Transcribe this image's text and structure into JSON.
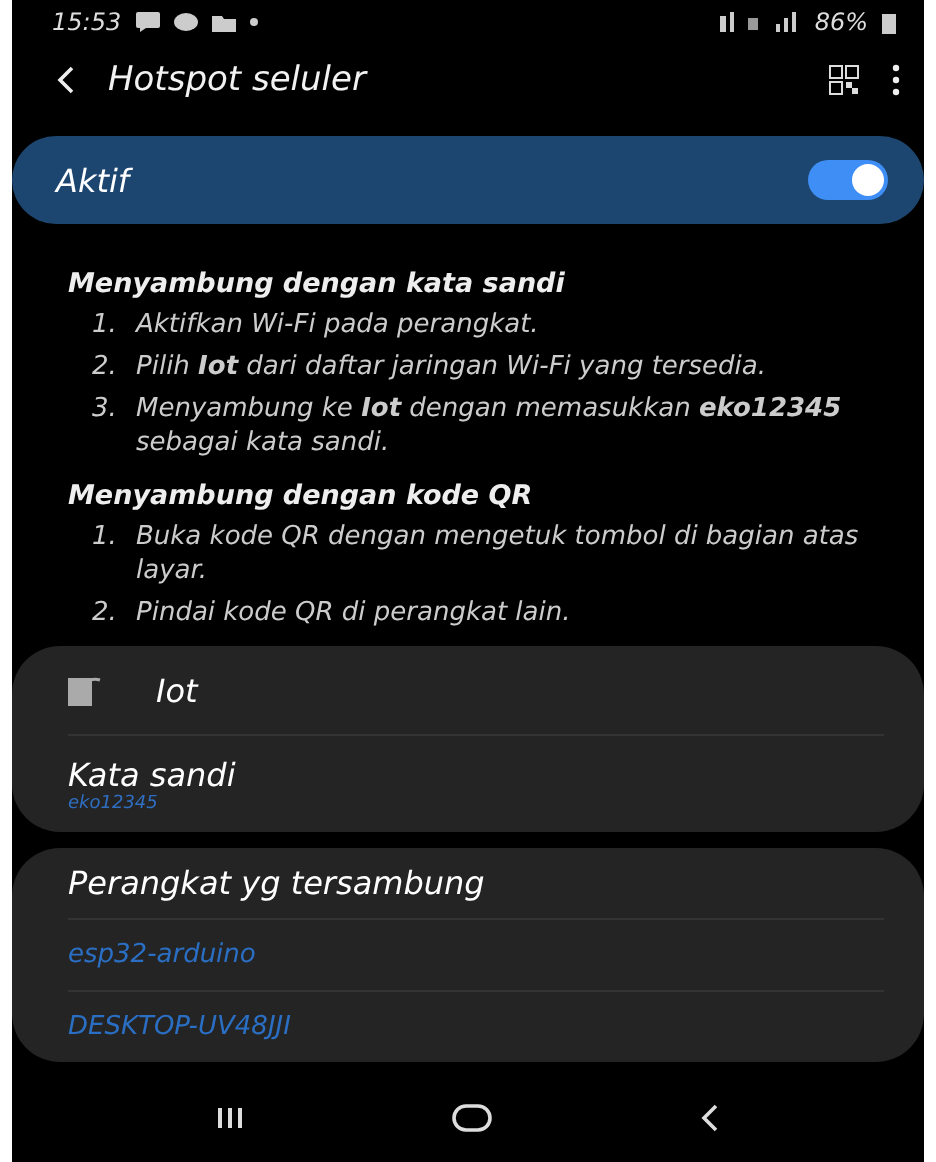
{
  "status_bar": {
    "time": "15:53",
    "battery": "86%"
  },
  "app_bar": {
    "title": "Hotspot seluler"
  },
  "master_switch": {
    "label": "Aktif",
    "on": true
  },
  "sections": [
    {
      "heading": "Menyambung dengan kata sandi",
      "steps": [
        {
          "number": "1.",
          "text": "Aktifkan Wi-Fi pada perangkat."
        },
        {
          "number": "2.",
          "text": "Pilih **Iot** dari daftar jaringan Wi-Fi yang tersedia."
        },
        {
          "number": "3.",
          "text": "Menyambung ke **Iot** dengan memasukkan **eko12345** sebagai kata sandi."
        }
      ]
    },
    {
      "heading": "Menyambung dengan kode QR",
      "steps": [
        {
          "number": "1.",
          "text": "Buka kode QR dengan mengetuk tombol di bagian atas layar."
        },
        {
          "number": "2.",
          "text": "Pindai kode QR di perangkat lain."
        }
      ]
    }
  ],
  "network": {
    "name": "Iot",
    "password_label": "Kata sandi",
    "password": "eko12345"
  },
  "connected": {
    "heading": "Perangkat yg tersambung",
    "devices": [
      "esp32-arduino",
      "DESKTOP-UV48JJI"
    ]
  }
}
